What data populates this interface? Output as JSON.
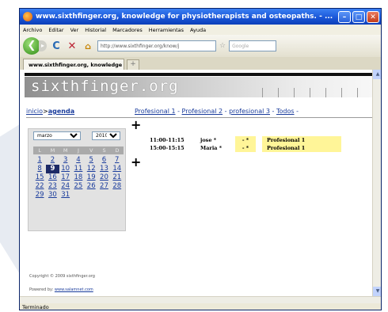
{
  "window": {
    "title": "www.sixthfinger.org, knowledge for physiotherapists and osteopaths. - ...",
    "buttons": {
      "minimize": "–",
      "maximize": "□",
      "close": "✕"
    }
  },
  "menubar": [
    "Archivo",
    "Editar",
    "Ver",
    "Historial",
    "Marcadores",
    "Herramientas",
    "Ayuda"
  ],
  "navbar": {
    "back": "❮",
    "forward": "▸",
    "reload": "C",
    "stop": "✕",
    "home": "⌂",
    "url": "http://www.sixthfinger.org/know/j",
    "search_placeholder": "Google"
  },
  "tabs": [
    {
      "label": "www.sixthfinger.org, knowledge for ..."
    }
  ],
  "newtab": "+",
  "page": {
    "logo_text": "sixthfinger.org",
    "nav": {
      "inicio": "inicio",
      "separator": ">",
      "agenda": "agenda"
    },
    "professional_links": [
      "Profesional 1",
      "Profesional 2",
      "profesional 3",
      "Todos"
    ],
    "link_separator": " - ",
    "plus": "+",
    "calendar": {
      "month": "marzo",
      "year": "2010",
      "weekdays": [
        "L",
        "M",
        "M",
        "J",
        "V",
        "S",
        "D"
      ],
      "weeks": [
        [
          "1",
          "2",
          "3",
          "4",
          "5",
          "6",
          "7"
        ],
        [
          "8",
          "9",
          "10",
          "11",
          "12",
          "13",
          "14"
        ],
        [
          "15",
          "16",
          "17",
          "18",
          "19",
          "20",
          "21"
        ],
        [
          "22",
          "23",
          "24",
          "25",
          "26",
          "27",
          "28"
        ],
        [
          "29",
          "30",
          "31"
        ]
      ],
      "today": "9"
    },
    "appointments": [
      {
        "time": "11:00-11:15",
        "name": "jose *",
        "mark1": "-",
        "mark2": "*",
        "professional": "Profesional 1"
      },
      {
        "time": "15:00-15:15",
        "name": "Maria *",
        "mark1": "-",
        "mark2": "*",
        "professional": "Profesional 1"
      }
    ],
    "footer": {
      "copyright": "Copyright © 2009 sixthfinger.org",
      "powered_prefix": "Powered by: ",
      "powered_link": "www.salamnet.com"
    }
  },
  "statusbar": {
    "text": "Terminado"
  },
  "colors": {
    "titlebar": "#1954d6",
    "highlight": "#fff598",
    "link": "#1a3c9c",
    "today": "#1d2a66"
  }
}
